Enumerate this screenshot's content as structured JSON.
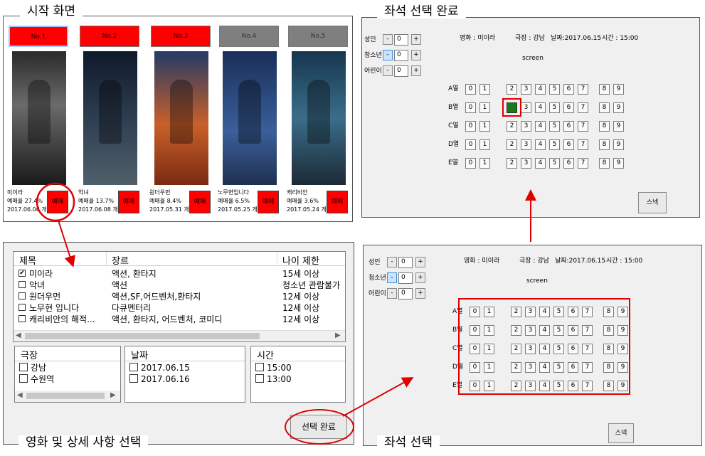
{
  "captions": {
    "start": "시작 화면",
    "seat_done": "좌석 선택 완료",
    "movie_select": "영화 및 상세 사항 선택",
    "seat_select": "좌석 선택"
  },
  "start_screen": {
    "tabs": [
      "No.1",
      "No.2",
      "No.3",
      "No.4",
      "No.5"
    ],
    "movies": [
      {
        "title": "미이라",
        "rate": "예매율   27.4%",
        "date": "2017.06.06 개봉",
        "button": "예매"
      },
      {
        "title": "악녀",
        "rate": "예매율   13.7%",
        "date": "2017.06.08 개봉",
        "button": "예매"
      },
      {
        "title": "원더우먼",
        "rate": "예매율   8.4%",
        "date": "2017.05.31 개봉",
        "button": "예매"
      },
      {
        "title": "노무현입니다",
        "rate": "예매율   6.5%",
        "date": "2017.05.25 개봉",
        "button": "예매"
      },
      {
        "title": "캐리비안",
        "rate": "예매율   3.6%",
        "date": "2017.05.24 개봉",
        "button": "예매"
      }
    ]
  },
  "movie_panel": {
    "headers": [
      "제목",
      "장르",
      "나이 제한"
    ],
    "rows": [
      {
        "title": "미이라",
        "genre": "액션, 환타지",
        "age": "15세 이상",
        "checked": "✔"
      },
      {
        "title": "악녀",
        "genre": "액션",
        "age": "청소년 관람불가",
        "checked": ""
      },
      {
        "title": "원더우먼",
        "genre": "액션,SF,어드벤처,환타지",
        "age": "12세 이상",
        "checked": ""
      },
      {
        "title": "노무현 입니다",
        "genre": "다큐멘터리",
        "age": "12세 이상",
        "checked": ""
      },
      {
        "title": "캐리비안의 해적...",
        "genre": "액션, 환타지, 어드벤처, 코미디",
        "age": "12세 이상",
        "checked": ""
      }
    ],
    "theater": {
      "header": "극장",
      "items": [
        "강남",
        "수원역"
      ]
    },
    "dates": {
      "header": "날짜",
      "items": [
        "2017.06.15",
        "2017.06.16"
      ]
    },
    "times": {
      "header": "시간",
      "items": [
        "15:00",
        "13:00"
      ]
    },
    "confirm_button": "선택 완료"
  },
  "seat_panel": {
    "counters": [
      {
        "label": "성인",
        "minus": "-",
        "value": "0",
        "plus": "+"
      },
      {
        "label": "청소년",
        "minus": "-",
        "value": "0",
        "plus": "+"
      },
      {
        "label": "어린이",
        "minus": "-",
        "value": "0",
        "plus": "+"
      }
    ],
    "info": {
      "movie": "영화 : 미이라",
      "theater": "극장 : 강남",
      "date": "날짜:2017.06.15",
      "time": "시간 : 15:00"
    },
    "screen": "screen",
    "rows": [
      "A열",
      "B열",
      "C열",
      "D열",
      "E열"
    ],
    "seats": [
      "0",
      "1",
      "2",
      "3",
      "4",
      "5",
      "6",
      "7",
      "8",
      "9"
    ],
    "selected_seat": {
      "row": "B열",
      "seat": "2"
    },
    "select_button": "스넥"
  },
  "colors": {
    "accent": "#ff0000",
    "selected_seat": "#1a7a1a",
    "panel": "#f0f0f0"
  }
}
